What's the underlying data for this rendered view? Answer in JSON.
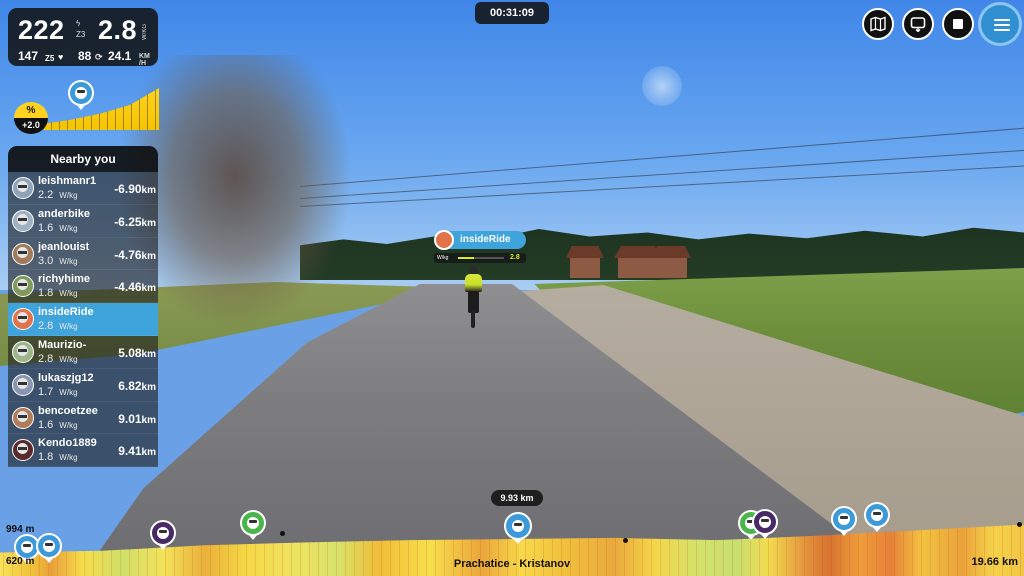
{
  "stats": {
    "power": "222",
    "power_icon": "lightning-icon",
    "power_zone": "Z3",
    "wkg": "2.8",
    "wkg_unit": "W/KG",
    "heart_rate": "147",
    "hr_zone": "Z5",
    "heart_icon": "heart-icon",
    "cadence": "88",
    "cadence_icon": "cadence-icon",
    "speed": "24.1",
    "speed_unit_top": "KM",
    "speed_unit_bottom": "/H"
  },
  "grade": {
    "symbol": "%",
    "value": "+2.0"
  },
  "timer": "00:31:09",
  "nearby": {
    "title": "Nearby you",
    "riders": [
      {
        "name": "leishmanr1",
        "wkg": "2.2",
        "unit": "W/kg",
        "gap": "-6.90",
        "gap_unit": "km",
        "me": false
      },
      {
        "name": "anderbike",
        "wkg": "1.6",
        "unit": "W/kg",
        "gap": "-6.25",
        "gap_unit": "km",
        "me": false
      },
      {
        "name": "jeanlouist",
        "wkg": "3.0",
        "unit": "W/kg",
        "gap": "-4.76",
        "gap_unit": "km",
        "me": false
      },
      {
        "name": "richyhime",
        "wkg": "1.8",
        "unit": "W/kg",
        "gap": "-4.46",
        "gap_unit": "km",
        "me": false
      },
      {
        "name": "insideRide",
        "wkg": "2.8",
        "unit": "W/kg",
        "gap": "",
        "gap_unit": "",
        "me": true
      },
      {
        "name": "Maurizio-",
        "wkg": "2.8",
        "unit": "W/kg",
        "gap": "5.08",
        "gap_unit": "km",
        "me": false
      },
      {
        "name": "lukaszjg12",
        "wkg": "1.7",
        "unit": "W/kg",
        "gap": "6.82",
        "gap_unit": "km",
        "me": false
      },
      {
        "name": "bencoetzee",
        "wkg": "1.6",
        "unit": "W/kg",
        "gap": "9.01",
        "gap_unit": "km",
        "me": false
      },
      {
        "name": "Kendo1889",
        "wkg": "1.8",
        "unit": "W/kg",
        "gap": "9.41",
        "gap_unit": "km",
        "me": false
      }
    ]
  },
  "rider_tag": {
    "name": "insideRide",
    "metric_label": "W/kg",
    "metric_value": "2.8",
    "metric_fraction": 0.35
  },
  "controls": {
    "map": "map-icon",
    "camera": "camera-switch-icon",
    "stop": "stop-icon",
    "menu": "hamburger-menu-icon"
  },
  "profile": {
    "max_elev": "994 m",
    "min_elev": "620 m",
    "current_distance": "9.93 km",
    "route_name": "Prachatice - Kristanov",
    "route_length": "19.66 km"
  },
  "colors": {
    "accent_blue": "#3fa4dc",
    "grade_yellow": "#ffd21f",
    "panel_dark": "#121212",
    "meter_lime": "#d6ec2b"
  }
}
